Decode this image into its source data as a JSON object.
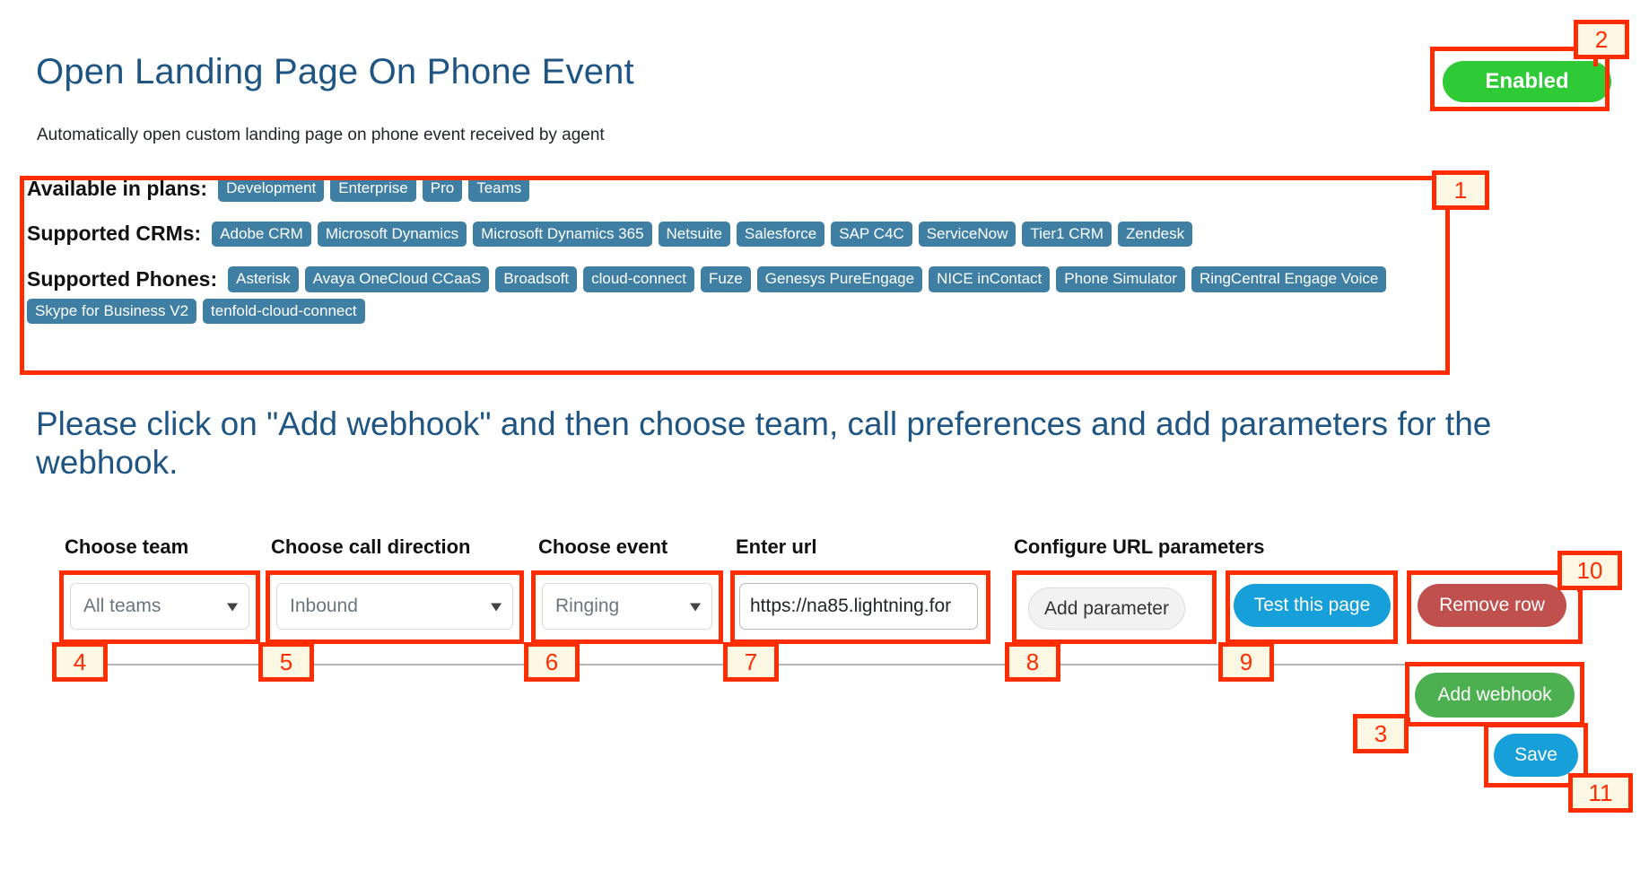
{
  "header": {
    "title": "Open Landing Page On Phone Event",
    "subtitle": "Automatically open custom landing page on phone event received by agent",
    "toggle_label": "Enabled",
    "toggle_color": "#2ecb36"
  },
  "capabilities": {
    "plans_label": "Available in plans:",
    "plans": [
      "Development",
      "Enterprise",
      "Pro",
      "Teams"
    ],
    "crms_label": "Supported CRMs:",
    "crms": [
      "Adobe CRM",
      "Microsoft Dynamics",
      "Microsoft Dynamics 365",
      "Netsuite",
      "Salesforce",
      "SAP C4C",
      "ServiceNow",
      "Tier1 CRM",
      "Zendesk"
    ],
    "phones_label": "Supported Phones:",
    "phones": [
      "Asterisk",
      "Avaya OneCloud CCaaS",
      "Broadsoft",
      "cloud-connect",
      "Fuze",
      "Genesys PureEngage",
      "NICE inContact",
      "Phone Simulator",
      "RingCentral Engage Voice",
      "Skype for Business V2",
      "tenfold-cloud-connect"
    ],
    "badge_color": "#3f7fa3"
  },
  "instruction": {
    "text": "Please click on \"Add webhook\" and then choose team, call preferences and add parameters for the webhook."
  },
  "form": {
    "columns": {
      "team": "Choose team",
      "call_direction": "Choose call direction",
      "event": "Choose event",
      "url": "Enter url",
      "url_params": "Configure URL parameters"
    },
    "team_value": "All teams",
    "call_direction_value": "Inbound",
    "event_value": "Ringing",
    "url_value": "https://na85.lightning.for",
    "url_placeholder": "Enter url",
    "add_parameter_label": "Add parameter",
    "test_page_label": "Test this page",
    "remove_row_label": "Remove row",
    "add_webhook_label": "Add webhook",
    "save_label": "Save",
    "chevron": "⌄"
  },
  "annotations": {
    "a1": "1",
    "a2": "2",
    "a3": "3",
    "a4": "4",
    "a5": "5",
    "a6": "6",
    "a7": "7",
    "a8": "8",
    "a9": "9",
    "a10": "10",
    "a11": "11",
    "color": "#ff2d00",
    "tag_background": "#fdf8e3"
  }
}
